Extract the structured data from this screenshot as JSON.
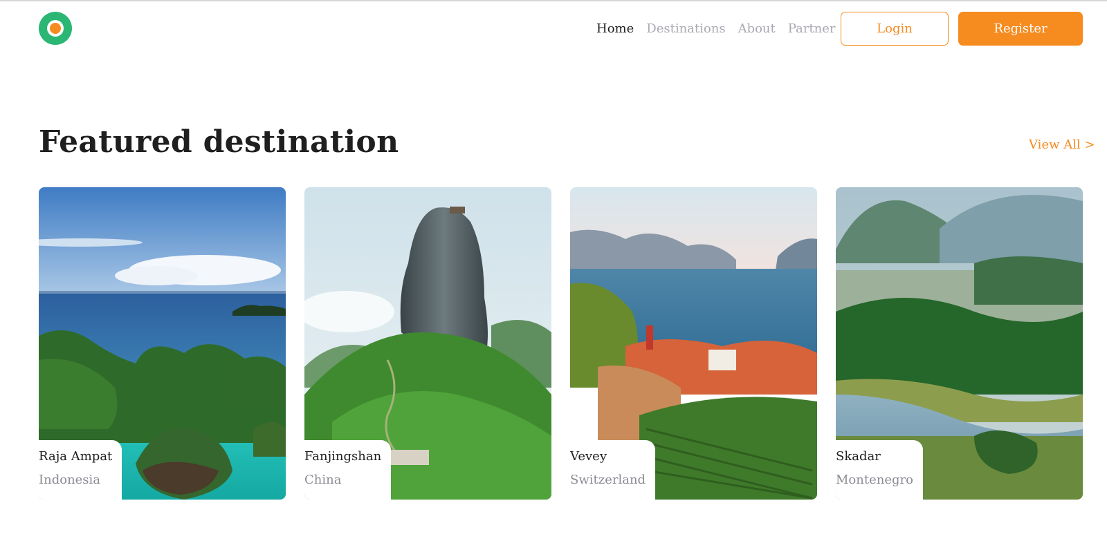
{
  "nav": {
    "items": [
      {
        "label": "Home",
        "active": true
      },
      {
        "label": "Destinations",
        "active": false
      },
      {
        "label": "About",
        "active": false
      },
      {
        "label": "Partner",
        "active": false
      }
    ],
    "login_label": "Login",
    "register_label": "Register"
  },
  "section": {
    "title": "Featured destination",
    "view_all": "View All >"
  },
  "cards": [
    {
      "name": "Raja Ampat",
      "country": "Indonesia"
    },
    {
      "name": "Fanjingshan",
      "country": "China"
    },
    {
      "name": "Vevey",
      "country": "Switzerland"
    },
    {
      "name": "Skadar",
      "country": "Montenegro"
    }
  ],
  "colors": {
    "accent": "#f68b1f",
    "logo_green": "#2bb673",
    "nav_inactive": "#a9a9b4",
    "text_dark": "#1f1f1f",
    "text_muted": "#8b8b93"
  }
}
